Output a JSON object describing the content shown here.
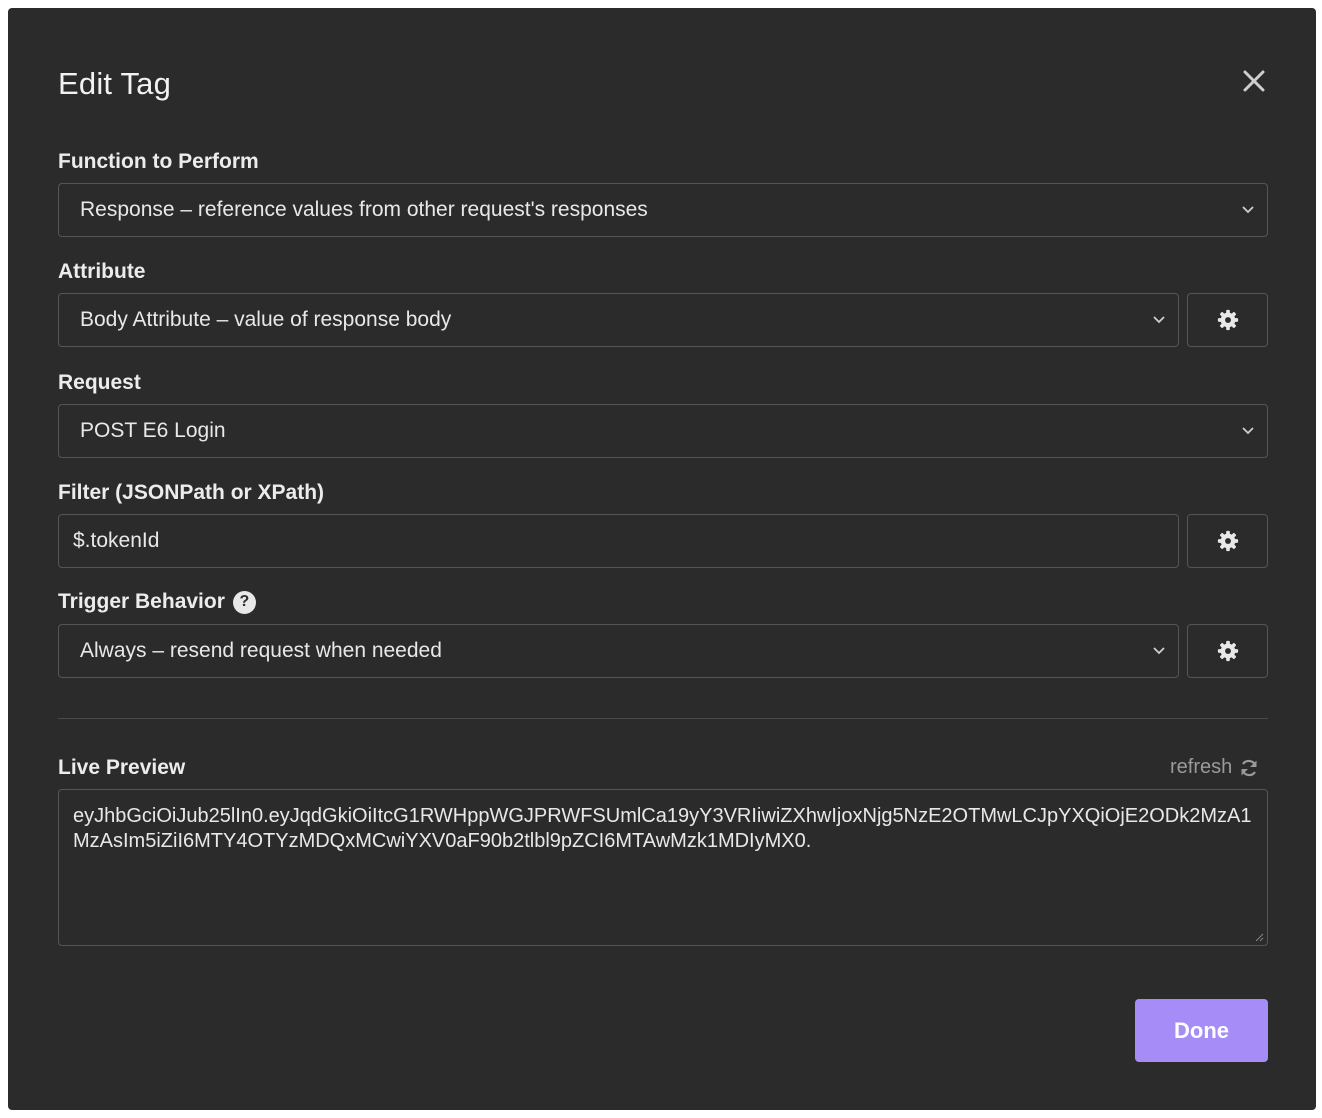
{
  "dialog": {
    "title": "Edit Tag",
    "close_icon": "close-icon"
  },
  "function_to_perform": {
    "label": "Function to Perform",
    "value": "Response – reference values from other request's responses"
  },
  "attribute": {
    "label": "Attribute",
    "value": "Body Attribute – value of response body",
    "settings_icon": "gear-icon"
  },
  "request": {
    "label": "Request",
    "value": "POST E6 Login"
  },
  "filter": {
    "label": "Filter (JSONPath or XPath)",
    "value": "$.tokenId",
    "settings_icon": "gear-icon"
  },
  "trigger_behavior": {
    "label": "Trigger Behavior",
    "help_glyph": "?",
    "value": "Always – resend request when needed",
    "settings_icon": "gear-icon"
  },
  "live_preview": {
    "label": "Live Preview",
    "refresh_label": "refresh",
    "value": "eyJhbGciOiJub25lIn0.eyJqdGkiOiItcG1RWHppWGJPRWFSUmlCa19yY3VRIiwiZXhwIjoxNjg5NzE2OTMwLCJpYXQiOjE2ODk2MzA1MzAsIm5iZiI6MTY4OTYzMDQxMCwiYXV0aF90b2tlbl9pZCI6MTAwMzk1MDIyMX0."
  },
  "footer": {
    "done_label": "Done"
  },
  "colors": {
    "background": "#2b2b2b",
    "border": "#555555",
    "primary_button": "#a58cf6",
    "muted_text": "#9a9a9a"
  }
}
